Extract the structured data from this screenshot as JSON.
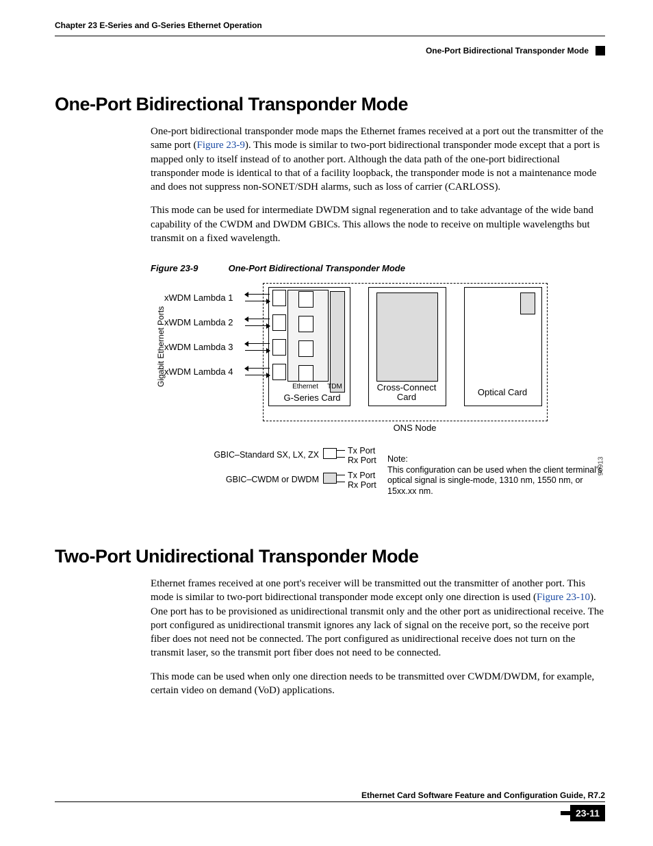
{
  "header": {
    "chapter": "Chapter 23   E-Series and G-Series Ethernet Operation",
    "section_right": "One-Port Bidirectional Transponder Mode"
  },
  "sections": {
    "s1": {
      "title": "One-Port Bidirectional Transponder Mode",
      "p1a": "One-port bidirectional transponder mode maps the Ethernet frames received at a port out the transmitter of the same port (",
      "p1_linktext": "Figure 23-9",
      "p1b": "). This mode is similar to two-port bidirectional transponder mode except that a port is mapped only to itself instead of to another port. Although the data path of the one-port bidirectional transponder mode is identical to that of a facility loopback, the transponder mode is not a maintenance mode and does not suppress non-SONET/SDH alarms, such as loss of carrier (CARLOSS).",
      "p2": "This mode can be used for intermediate DWDM signal regeneration and to take advantage of the wide band capability of the CWDM and DWDM GBICs. This allows the node to receive on multiple wavelengths but transmit on a fixed wavelength."
    },
    "figure": {
      "num": "Figure 23-9",
      "title": "One-Port Bidirectional Transponder Mode",
      "vert_label": "Gigabit Ethernet Ports",
      "lambdas": [
        "xWDM Lambda 1",
        "xWDM Lambda 2",
        "xWDM Lambda 3",
        "xWDM Lambda 4"
      ],
      "tiny_eth": "Ethernet",
      "tiny_tdm": "TDM",
      "gseries": "G-Series Card",
      "xc": "Cross-Connect Card",
      "optical": "Optical Card",
      "ons": "ONS Node",
      "legend1_label": "GBIC–Standard SX, LX, ZX",
      "legend2_label": "GBIC–CWDM or DWDM",
      "tx": "Tx Port",
      "rx": "Rx Port",
      "note_hdr": "Note:",
      "note_body": "This configuration can be used when the client terminal's optical signal is single-mode, 1310 nm, 1550 nm, or 15xx.xx nm.",
      "sidenum": "90913"
    },
    "s2": {
      "title": "Two-Port Unidirectional Transponder Mode",
      "p1a": "Ethernet frames received at one port's receiver will be transmitted out the transmitter of another port. This mode is similar to two-port bidirectional transponder mode except only one direction is used (",
      "p1_linktext": "Figure 23-10",
      "p1b": "). One port has to be provisioned as unidirectional transmit only and the other port as unidirectional receive. The port configured as unidirectional transmit ignores any lack of signal on the receive port, so the receive port fiber does not need not be connected. The port configured as unidirectional receive does not turn on the transmit laser, so the transmit port fiber does not need to be connected.",
      "p2": "This mode can be used when only one direction needs to be transmitted over CWDM/DWDM, for example, certain video on demand (VoD) applications."
    }
  },
  "footer": {
    "guide": "Ethernet Card Software Feature and Configuration Guide, R7.2",
    "page": "23-11"
  }
}
